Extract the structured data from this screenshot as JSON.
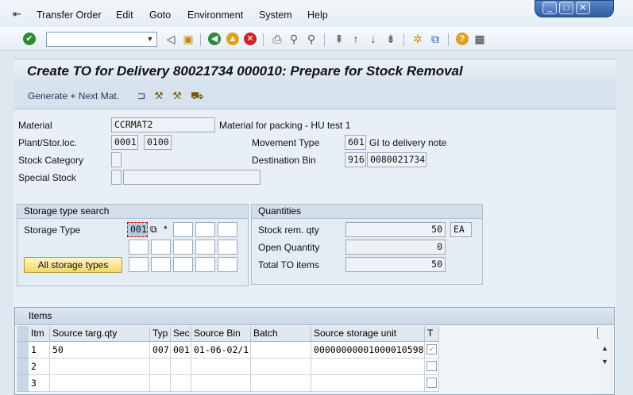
{
  "menubar": {
    "items": [
      "Transfer Order",
      "Edit",
      "Goto",
      "Environment",
      "System",
      "Help"
    ]
  },
  "window_controls": {
    "minimize": "_",
    "restore": "□",
    "close": "✕"
  },
  "toolbar": {
    "command_field_value": ""
  },
  "title": "Create TO for Delivery 80021734 000010: Prepare for Stock Removal",
  "app_toolbar": {
    "generate_label": "Generate + Next Mat."
  },
  "header": {
    "material_label": "Material",
    "material_value": "CCRMAT2",
    "material_desc": "Material for packing - HU test 1",
    "plant_label": "Plant/Stor.loc.",
    "plant_value": "0001",
    "storloc_value": "0100",
    "movement_type_label": "Movement Type",
    "movement_type_value": "601",
    "movement_type_desc": "GI to delivery note",
    "stock_category_label": "Stock Category",
    "stock_category_value": "",
    "destination_bin_label": "Destination Bin",
    "dest_type_value": "916",
    "dest_bin_value": "0080021734",
    "special_stock_label": "Special Stock",
    "special_stock_value": "",
    "special_stock_desc": ""
  },
  "storage_type_search": {
    "title": "Storage type search",
    "storage_type_label": "Storage Type",
    "first_value": "001",
    "wildcard": "*",
    "all_types_button": "All storage types"
  },
  "quantities": {
    "title": "Quantities",
    "stock_rem_label": "Stock rem. qty",
    "stock_rem_value": "50",
    "stock_rem_unit": "EA",
    "open_qty_label": "Open Quantity",
    "open_qty_value": "0",
    "total_to_label": "Total TO items",
    "total_to_value": "50"
  },
  "items": {
    "title": "Items",
    "columns": [
      "Itm",
      "Source targ.qty",
      "Typ",
      "Sec",
      "Source Bin",
      "Batch",
      "Source storage unit",
      "T"
    ],
    "rows": [
      {
        "itm": "1",
        "qty": "50",
        "typ": "007",
        "sec": "001",
        "bin": "01-06-02/1",
        "batch": "",
        "su": "00000000001000010598",
        "checked": true
      },
      {
        "itm": "2",
        "qty": "",
        "typ": "",
        "sec": "",
        "bin": "",
        "batch": "",
        "su": "",
        "checked": false
      },
      {
        "itm": "3",
        "qty": "",
        "typ": "",
        "sec": "",
        "bin": "",
        "batch": "",
        "su": "",
        "checked": false
      }
    ]
  }
}
